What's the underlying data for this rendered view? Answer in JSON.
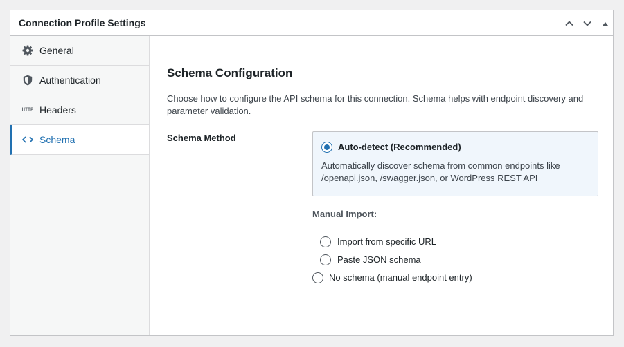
{
  "panel": {
    "title": "Connection Profile Settings",
    "controls": [
      "chevron-up-icon",
      "chevron-down-icon",
      "triangle-up-icon"
    ]
  },
  "sidebar": {
    "items": [
      {
        "label": "General",
        "icon": "gear-icon",
        "active": false
      },
      {
        "label": "Authentication",
        "icon": "shield-icon",
        "active": false
      },
      {
        "label": "Headers",
        "icon": "http-icon",
        "icon_text": "HTTP",
        "active": false
      },
      {
        "label": "Schema",
        "icon": "code-icon",
        "active": true
      }
    ]
  },
  "main": {
    "section_title": "Schema Configuration",
    "section_description": "Choose how to configure the API schema for this connection. Schema helps with endpoint discovery and parameter validation.",
    "field_label": "Schema Method",
    "options": {
      "auto_detect": {
        "label": "Auto-detect (Recommended)",
        "description": "Automatically discover schema from common endpoints like /openapi.json, /swagger.json, or WordPress REST API",
        "checked": true
      },
      "manual_import_label": "Manual Import:",
      "import_url": {
        "label": "Import from specific URL",
        "checked": false
      },
      "paste_json": {
        "label": "Paste JSON schema",
        "checked": false
      },
      "no_schema": {
        "label": "No schema (manual endpoint entry)",
        "checked": false
      }
    }
  },
  "colors": {
    "accent": "#2271b1",
    "border": "#c3c4c7",
    "option_highlight": "#f0f6fc",
    "background": "#f0f0f1"
  }
}
